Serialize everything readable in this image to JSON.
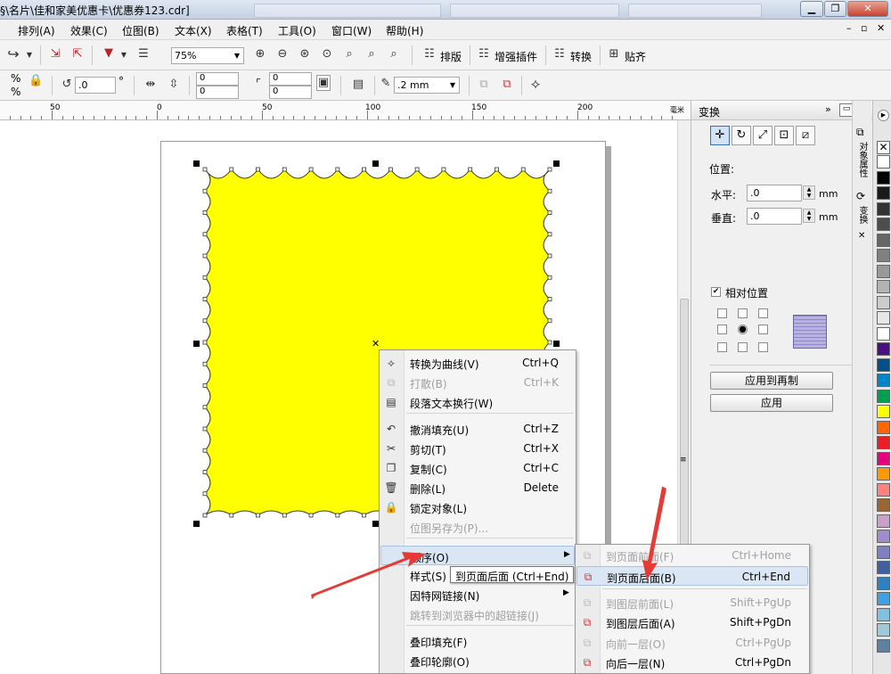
{
  "title": "§\\名片\\佳和家美优惠卡\\优惠券123.cdr]",
  "menu": [
    "排列(A)",
    "效果(C)",
    "位图(B)",
    "文本(X)",
    "表格(T)",
    "工具(O)",
    "窗口(W)",
    "帮助(H)"
  ],
  "toolbar1": {
    "zoom": "75%",
    "arrange": "排版",
    "enhance": "增强插件",
    "convert": "转换",
    "snap": "贴齐"
  },
  "toolbar2": {
    "percent_sym": "%",
    "angle": ".0",
    "degree": "°",
    "pos1": "0",
    "pos2": "0",
    "pos3": "0",
    "pos4": "0",
    "outline": ".2 mm"
  },
  "ruler": {
    "labels": [
      "50",
      "0",
      "50",
      "100",
      "150",
      "200"
    ],
    "unit": "毫米"
  },
  "docker": {
    "title": "变换",
    "position_label": "位置:",
    "horizontal_label": "水平:",
    "horizontal_value": ".0",
    "vertical_label": "垂直:",
    "vertical_value": ".0",
    "unit": "mm",
    "relative_label": "相对位置",
    "apply_dup": "应用到再制",
    "apply": "应用"
  },
  "sidetabs": {
    "tab1": "对象属性",
    "tab2": "变换"
  },
  "palette": [
    "#ffffff",
    "#000000",
    "#1a1a1a",
    "#333333",
    "#4d4d4d",
    "#666666",
    "#808080",
    "#999999",
    "#b3b3b3",
    "#cccccc",
    "#e6e6e6",
    "#ffffff",
    "#4b0f82",
    "#00508c",
    "#0086c8",
    "#00a050",
    "#ffff00",
    "#ff6600",
    "#ee1c25",
    "#e6007e",
    "#ff9900",
    "#ff8080",
    "#996633",
    "#c8a0c8",
    "#a08cc8",
    "#8080c0",
    "#4060a0",
    "#3080c0",
    "#40a0e0",
    "#80c0e0",
    "#a0c8d8",
    "#6080a0"
  ],
  "context_menu": [
    {
      "icon": "convert-curve-icon",
      "label": "转换为曲线(V)",
      "shortcut": "Ctrl+Q",
      "disabled": false
    },
    {
      "icon": "break-apart-icon",
      "label": "打散(B)",
      "shortcut": "Ctrl+K",
      "disabled": true
    },
    {
      "icon": "paragraph-wrap-icon",
      "label": "段落文本换行(W)",
      "shortcut": "",
      "disabled": false
    },
    {
      "icon": "undo-icon",
      "label": "撤消填充(U)",
      "shortcut": "Ctrl+Z",
      "disabled": false
    },
    {
      "icon": "scissors-icon",
      "label": "剪切(T)",
      "shortcut": "Ctrl+X",
      "disabled": false
    },
    {
      "icon": "copy-icon",
      "label": "复制(C)",
      "shortcut": "Ctrl+C",
      "disabled": false
    },
    {
      "icon": "trash-icon",
      "label": "删除(L)",
      "shortcut": "Delete",
      "disabled": false
    },
    {
      "icon": "lock-icon",
      "label": "锁定对象(L)",
      "shortcut": "",
      "disabled": false
    },
    {
      "icon": "",
      "label": "位图另存为(P)...",
      "shortcut": "",
      "disabled": true
    },
    {
      "icon": "",
      "label": "顺序(O)",
      "shortcut": "",
      "disabled": false
    },
    {
      "icon": "",
      "label": "样式(S)",
      "shortcut": "",
      "disabled": false
    },
    {
      "icon": "",
      "label": "因特网链接(N)",
      "shortcut": "",
      "disabled": false
    },
    {
      "icon": "",
      "label": "跳转到浏览器中的超链接(J)",
      "shortcut": "",
      "disabled": true
    },
    {
      "icon": "",
      "label": "叠印填充(F)",
      "shortcut": "",
      "disabled": false
    },
    {
      "icon": "",
      "label": "叠印轮廓(O)",
      "shortcut": "",
      "disabled": false
    }
  ],
  "submenu": [
    {
      "label": "到页面前面(F)",
      "shortcut": "Ctrl+Home",
      "disabled": true
    },
    {
      "label": "到页面后面(B)",
      "shortcut": "Ctrl+End",
      "disabled": false
    },
    {
      "label": "到图层前面(L)",
      "shortcut": "Shift+PgUp",
      "disabled": true
    },
    {
      "label": "到图层后面(A)",
      "shortcut": "Shift+PgDn",
      "disabled": false
    },
    {
      "label": "向前一层(O)",
      "shortcut": "Ctrl+PgUp",
      "disabled": true
    },
    {
      "label": "向后一层(N)",
      "shortcut": "Ctrl+PgDn",
      "disabled": false
    }
  ],
  "tooltip": "到页面后面 (Ctrl+End)"
}
